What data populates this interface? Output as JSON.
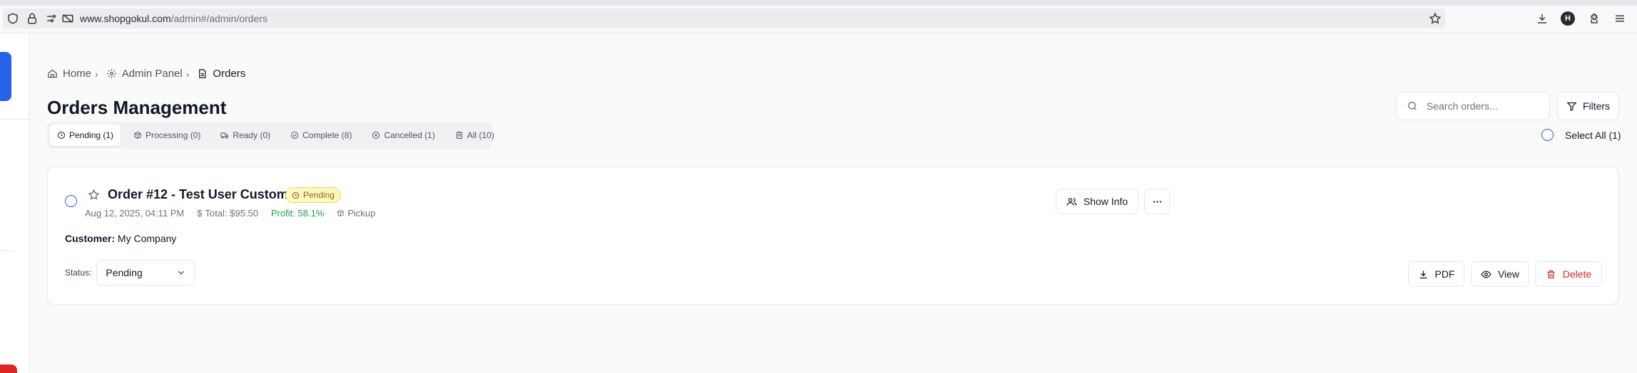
{
  "browser": {
    "url_host": "www.shopgokul.com",
    "url_path": "/admin#/admin/orders",
    "profile_initial": "H"
  },
  "breadcrumb": {
    "home": "Home",
    "admin_panel": "Admin Panel",
    "current": "Orders"
  },
  "page": {
    "title": "Orders Management"
  },
  "tabs": [
    {
      "label": "Pending (1)",
      "icon": "clock-icon",
      "active": true
    },
    {
      "label": "Processing (0)",
      "icon": "package-icon",
      "active": false
    },
    {
      "label": "Ready (0)",
      "icon": "truck-icon",
      "active": false
    },
    {
      "label": "Complete (8)",
      "icon": "check-circle-icon",
      "active": false
    },
    {
      "label": "Cancelled (1)",
      "icon": "x-circle-icon",
      "active": false
    },
    {
      "label": "All (10)",
      "icon": "clipboard-icon",
      "active": false
    }
  ],
  "search": {
    "placeholder": "Search orders...",
    "value": ""
  },
  "toolbar": {
    "filters_label": "Filters",
    "select_all_label": "Select All (1)"
  },
  "order": {
    "title": "Order #12 - Test User Customer",
    "status_badge": "Pending",
    "date": "Aug 12, 2025, 04:11 PM",
    "total": "Total: $95.50",
    "profit": "Profit: 58.1%",
    "fulfillment": "Pickup",
    "customer_label": "Customer:",
    "customer_value": "My Company",
    "status_label": "Status:",
    "status_value": "Pending",
    "show_info_label": "Show Info",
    "pdf_label": "PDF",
    "view_label": "View",
    "delete_label": "Delete"
  },
  "colors": {
    "accent": "#2563eb",
    "pending_badge_bg": "#fef9c3",
    "pending_badge_text": "#a16207",
    "profit": "#16a34a",
    "danger": "#dc2626"
  }
}
